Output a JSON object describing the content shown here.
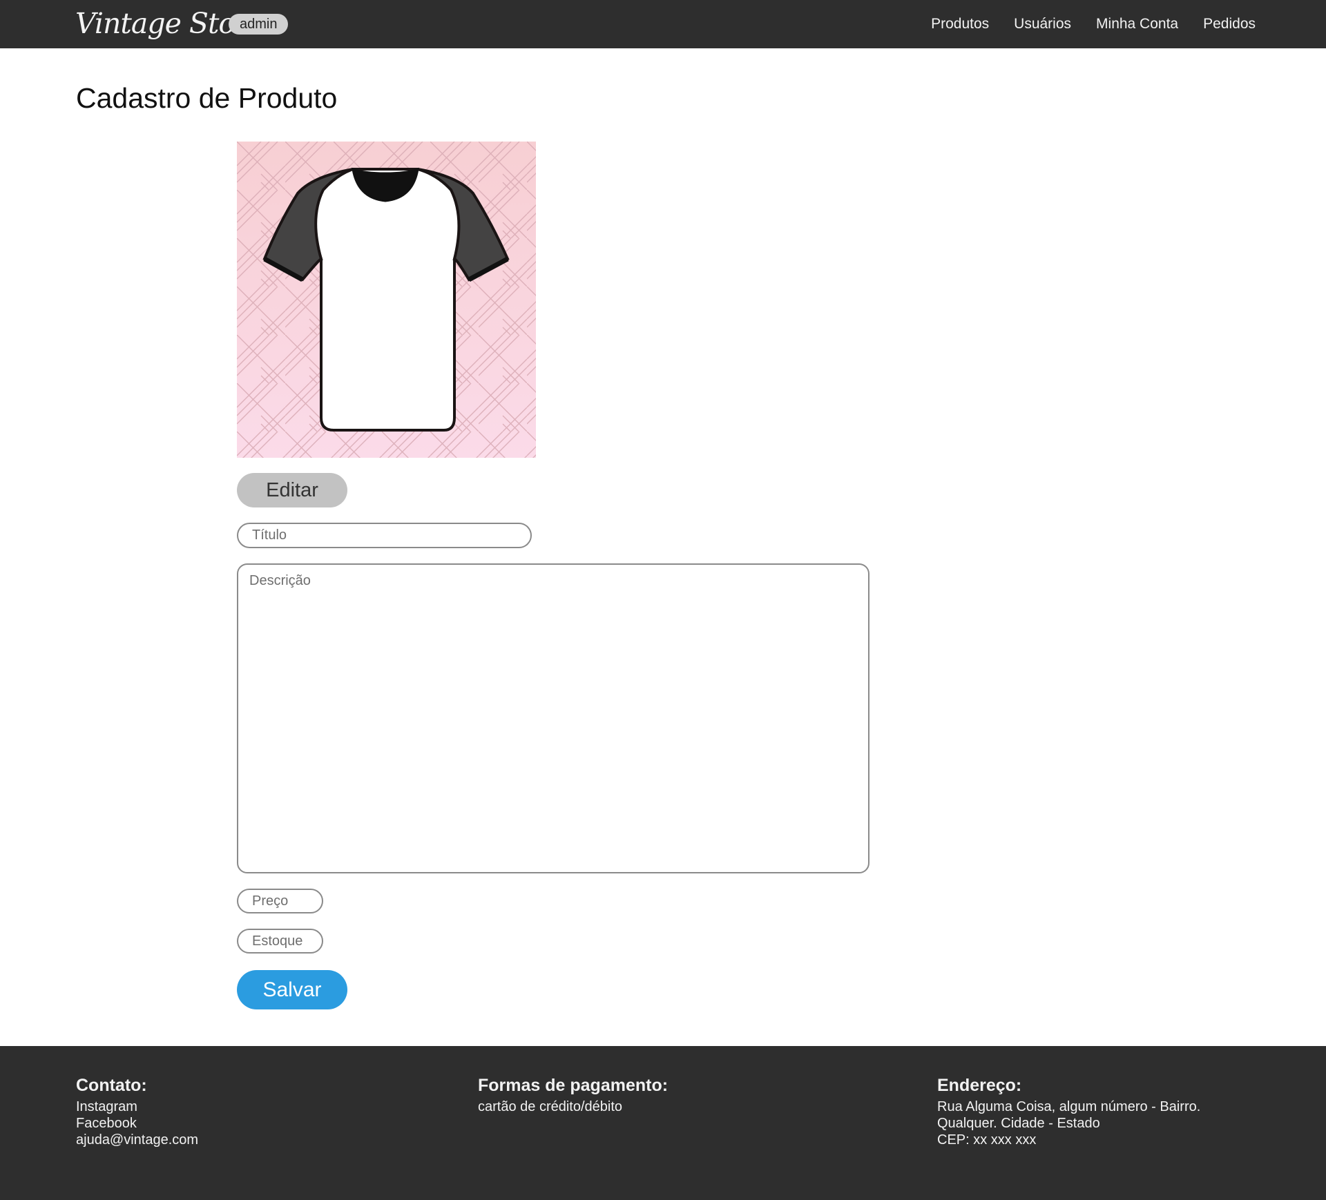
{
  "header": {
    "brand": "Vintage Store",
    "role_badge": "admin",
    "nav": [
      "Produtos",
      "Usuários",
      "Minha Conta",
      "Pedidos"
    ]
  },
  "main": {
    "title": "Cadastro de Produto",
    "edit_label": "Editar",
    "title_placeholder": "Título",
    "description_placeholder": "Descrição",
    "price_placeholder": "Preço",
    "stock_placeholder": "Estoque",
    "save_label": "Salvar"
  },
  "footer": {
    "contact": {
      "heading": "Contato:",
      "lines": [
        "Instagram",
        "Facebook",
        "ajuda@vintage.com"
      ]
    },
    "payment": {
      "heading": "Formas de pagamento:",
      "lines": [
        "cartão de crédito/débito"
      ]
    },
    "address": {
      "heading": "Endereço:",
      "lines": [
        "Rua Alguma Coisa, algum número - Bairro.",
        "Qualquer. Cidade - Estado",
        "CEP: xx xxx xxx"
      ]
    }
  },
  "colors": {
    "navbar": "#2e2e2e",
    "save_button": "#2b9ce0",
    "edit_button": "#c2c2c2",
    "image_background": "#f9cfd8"
  }
}
